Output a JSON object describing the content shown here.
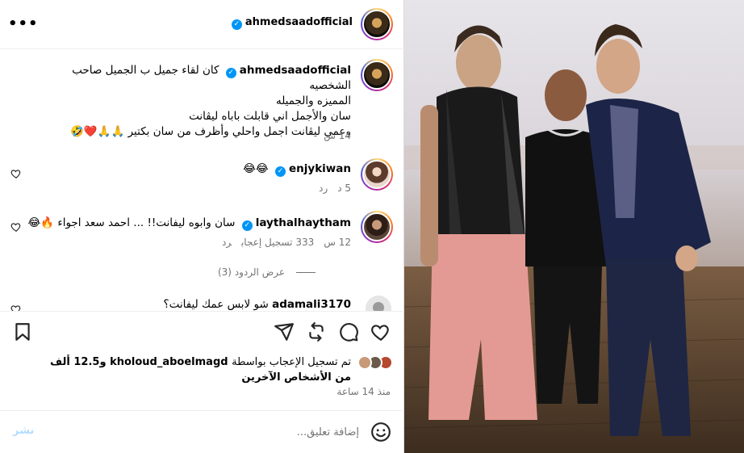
{
  "header": {
    "username": "ahmedsaadofficial",
    "more_label": "•••"
  },
  "caption": {
    "username": "ahmedsaadofficial",
    "lines": [
      "كان لقاء جميل ب الجميل صاحب الشخصيه",
      "المميزه والجميله",
      "سان والأجمل اني قابلت باباه ليڤانت",
      "وعمي ليڤانت اجمل واحلي وأظرف من سان بكتير 🙏🙏❤️🤣"
    ],
    "time": "14 س"
  },
  "comments": [
    {
      "username": "enjykiwan",
      "text": "😂😂",
      "time": "5 د",
      "reply": "رد"
    },
    {
      "username": "laythalhaytham",
      "text": "سان وابوه ليفانت!! ... احمد سعد اجواء 🔥😂",
      "time": "12 س",
      "likes": "333 تسجيل إعجاب",
      "reply": "رد"
    },
    {
      "username": "adamali3170",
      "text": "شو لابس عمك ليفانت؟"
    }
  ],
  "view_replies": "عرض الردود (3)",
  "likes": {
    "prefix": "تم تسجيل الإعجاب بواسطة",
    "user": "kholoud_aboelmagd",
    "rest": "و12.5 ألف من الأشخاص الآخرين"
  },
  "post_time": "منذ 14 ساعة",
  "add_comment": {
    "placeholder": "إضافة تعليق...",
    "post_label": "نشر"
  }
}
